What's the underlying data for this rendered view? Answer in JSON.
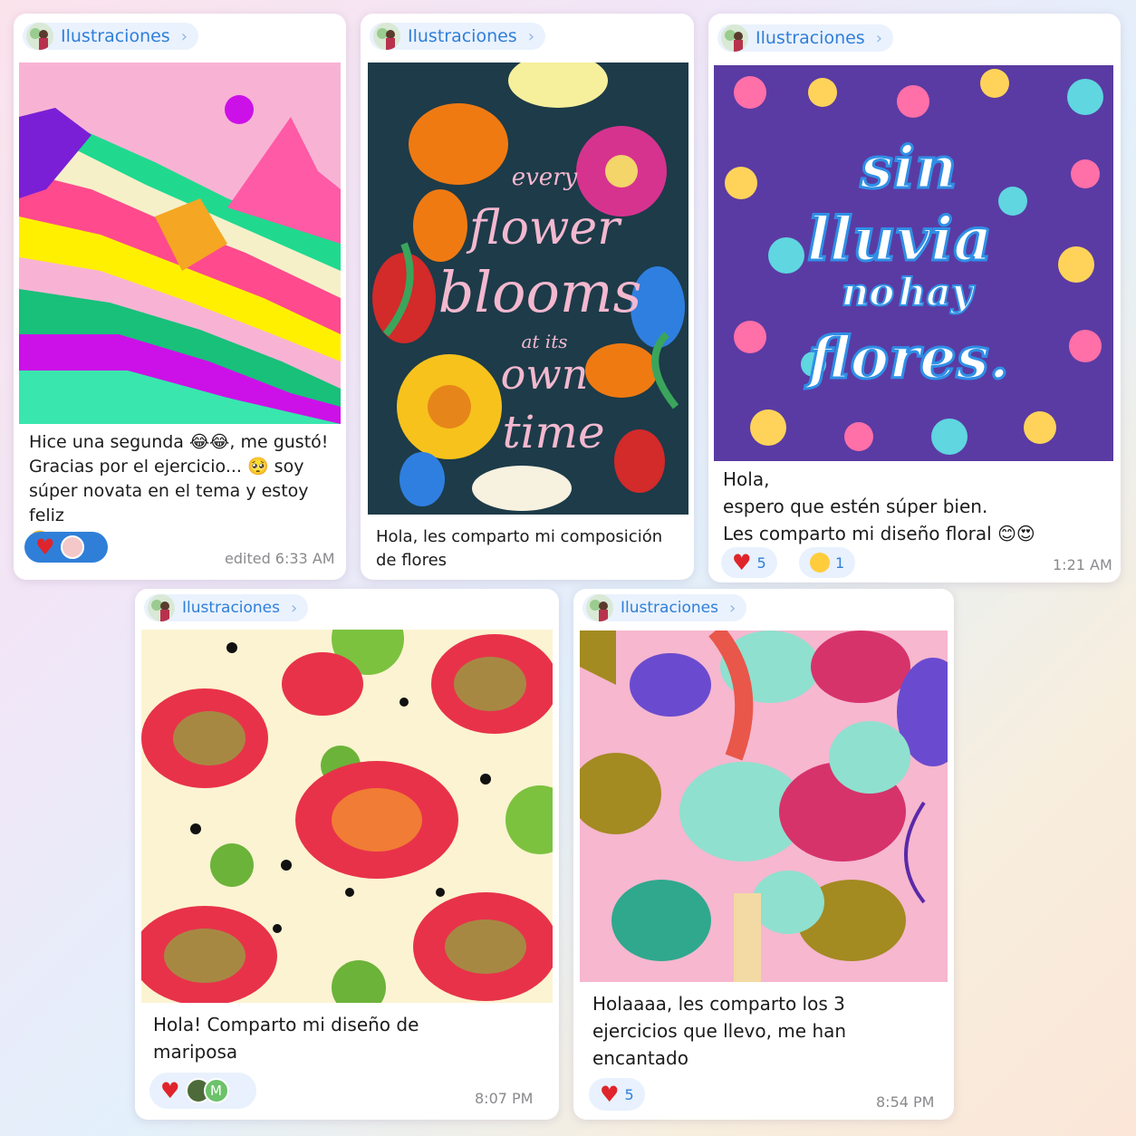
{
  "channel_name": "Ilustraciones",
  "posts": [
    {
      "message": "Hice una segunda 😂😂, me gustó!\nGracias por el ejercicio... 🥺 soy\nsúper novata en el tema y estoy feliz\n🙂",
      "time": "edited 6:33 AM",
      "reactions": [
        {
          "emoji": "heart",
          "count": ""
        }
      ]
    },
    {
      "message": "Hola, les comparto mi composición\nde flores",
      "time": "",
      "art_text": [
        "every",
        "flower",
        "blooms",
        "at its",
        "own",
        "time"
      ]
    },
    {
      "message": "Hola,\nespero que estén súper bien.\nLes comparto mi diseño floral 😊😍",
      "time": "1:21 AM",
      "reactions": [
        {
          "emoji": "heart",
          "count": "5"
        },
        {
          "emoji": "smiling-face-with-hearts",
          "count": "1"
        }
      ],
      "art_text": [
        "sin",
        "lluvia",
        "no",
        "hay",
        "flores."
      ]
    },
    {
      "message": "Hola! Comparto mi diseño de\nmariposa",
      "time": "8:07 PM",
      "reactions": [
        {
          "emoji": "heart",
          "count": ""
        }
      ],
      "reactor_initial": "M"
    },
    {
      "message": "Holaaaa, les comparto los 3\nejercicios que llevo, me han\nencantado",
      "time": "8:54 PM",
      "reactions": [
        {
          "emoji": "heart",
          "count": "5"
        }
      ]
    }
  ],
  "colors": {
    "accent": "#2f7fd8",
    "heart": "#e0242b",
    "chip_bg": "#eaf2fd"
  }
}
